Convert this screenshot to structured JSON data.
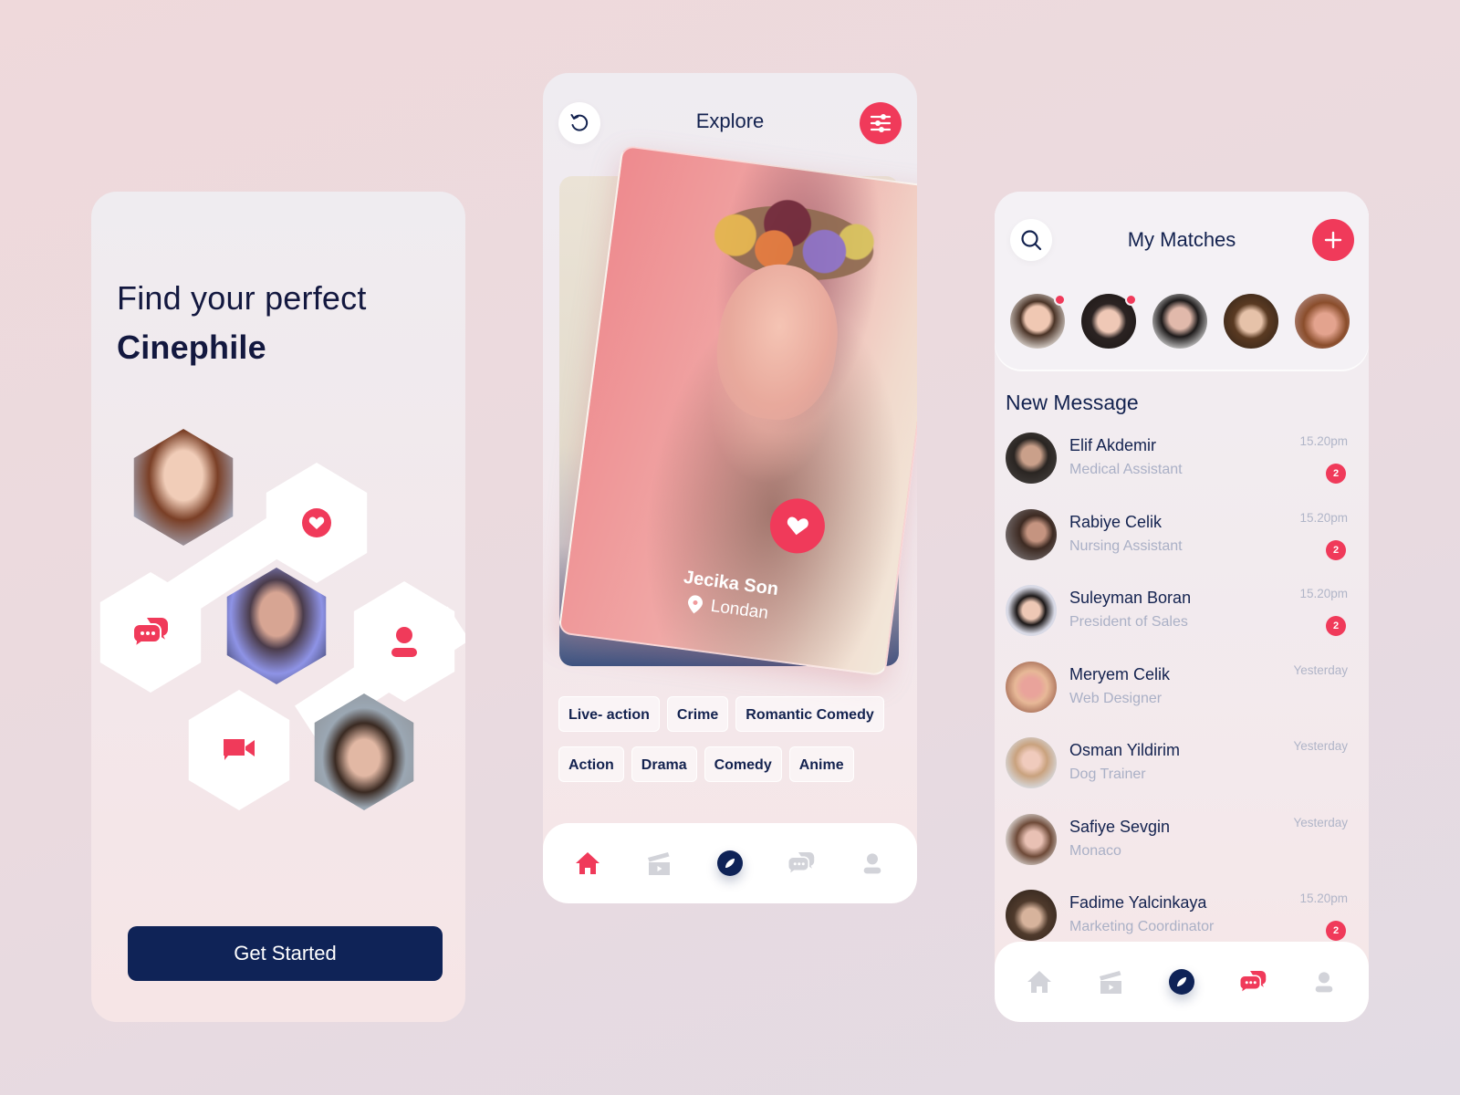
{
  "colors": {
    "accent": "#f03a5a",
    "navy": "#0f2357",
    "text": "#13224f",
    "muted": "#aab0c6",
    "inactive_icon": "#d2d3d9"
  },
  "onboarding": {
    "title_line1": "Find your perfect",
    "title_line2": "Cinephile",
    "feature_icons": [
      "heart-icon",
      "chat-bubbles-icon",
      "user-icon",
      "video-camera-icon"
    ],
    "cta_label": "Get Started"
  },
  "explore": {
    "title": "Explore",
    "left_button_icon": "refresh-icon",
    "right_button_icon": "filter-sliders-icon",
    "card": {
      "name": "Jecika Son",
      "location": "Londan",
      "like_icon": "heart-icon"
    },
    "genre_tags": [
      [
        "Live- action",
        "Crime",
        "Romantic Comedy"
      ],
      [
        "Action",
        "Drama",
        "Comedy",
        "Anime"
      ]
    ],
    "nav": {
      "items": [
        "home-icon",
        "clapperboard-icon",
        "compass-icon",
        "chat-bubbles-icon",
        "user-icon"
      ],
      "active": "home"
    }
  },
  "matches": {
    "title": "My Matches",
    "left_button_icon": "search-icon",
    "right_button_icon": "plus-icon",
    "stories": [
      {
        "unread": true
      },
      {
        "unread": true
      },
      {
        "unread": false
      },
      {
        "unread": false
      },
      {
        "unread": false
      }
    ],
    "section_title": "New Message",
    "messages": [
      {
        "name": "Elif Akdemir",
        "role": "Medical Assistant",
        "time": "15.20pm",
        "badge": "2"
      },
      {
        "name": "Rabiye Celik",
        "role": "Nursing Assistant",
        "time": "15.20pm",
        "badge": "2"
      },
      {
        "name": "Suleyman Boran",
        "role": "President of Sales",
        "time": "15.20pm",
        "badge": "2"
      },
      {
        "name": "Meryem Celik",
        "role": "Web Designer",
        "time": "Yesterday",
        "badge": null
      },
      {
        "name": "Osman Yildirim",
        "role": "Dog Trainer",
        "time": "Yesterday",
        "badge": null
      },
      {
        "name": "Safiye Sevgin",
        "role": "Monaco",
        "time": "Yesterday",
        "badge": null
      },
      {
        "name": "Fadime Yalcinkaya",
        "role": "Marketing Coordinator",
        "time": "15.20pm",
        "badge": "2"
      }
    ],
    "nav": {
      "items": [
        "home-icon",
        "clapperboard-icon",
        "compass-icon",
        "chat-bubbles-icon",
        "user-icon"
      ],
      "active": "chat"
    }
  }
}
